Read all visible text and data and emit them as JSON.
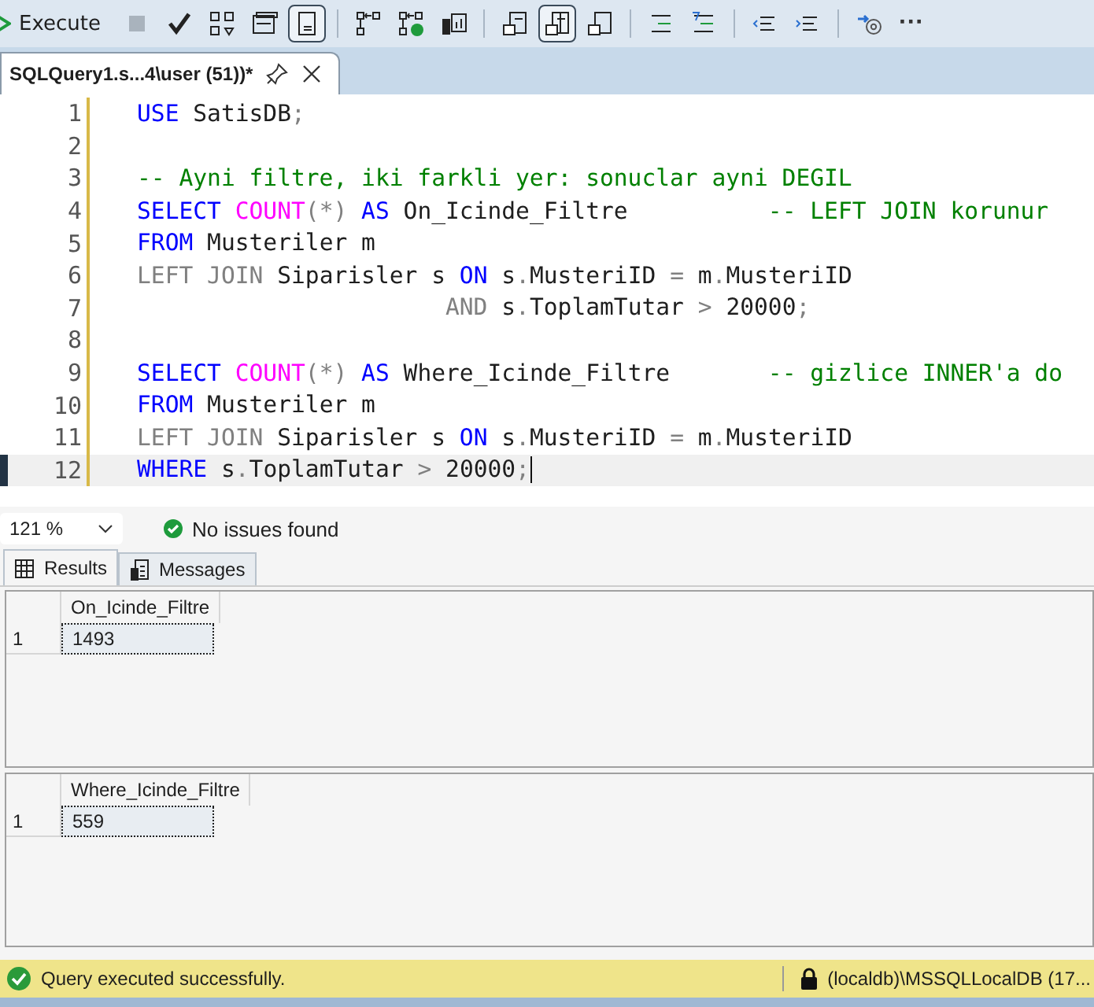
{
  "toolbar": {
    "execute": "Execute",
    "groups": [
      [
        {
          "kind": "stop",
          "selected": false
        },
        {
          "kind": "parse",
          "selected": false
        },
        {
          "kind": "plan",
          "selected": false
        },
        {
          "kind": "window",
          "selected": false
        },
        {
          "kind": "form",
          "selected": true
        }
      ],
      [
        {
          "kind": "link",
          "selected": false
        },
        {
          "kind": "linkok",
          "selected": false
        },
        {
          "kind": "stats",
          "selected": false
        }
      ],
      [
        {
          "kind": "text",
          "selected": false
        },
        {
          "kind": "grid",
          "selected": true
        },
        {
          "kind": "file",
          "selected": false
        }
      ],
      [
        {
          "kind": "comment",
          "selected": false
        },
        {
          "kind": "uncomment",
          "selected": false
        }
      ],
      [
        {
          "kind": "outdent",
          "selected": false
        },
        {
          "kind": "indent",
          "selected": false
        }
      ],
      [
        {
          "kind": "param",
          "selected": false
        }
      ]
    ],
    "more": "···"
  },
  "tabs": [
    {
      "label": "SQLQuery1.s...4\\user (51))*",
      "selected": true
    }
  ],
  "editor": {
    "lines": [
      {
        "number": "1",
        "tokens": [
          {
            "kind": "kw",
            "text": "USE"
          },
          {
            "kind": "id",
            "text": " SatisDB"
          },
          {
            "kind": "op",
            "text": ";"
          }
        ]
      },
      {
        "number": "2"
      },
      {
        "number": "3",
        "tokens": [
          {
            "kind": "cm",
            "text": "-- Ayni filtre, iki farkli yer: sonuclar ayni DEGIL"
          }
        ]
      },
      {
        "number": "4",
        "tokens": [
          {
            "kind": "kw",
            "text": "SELECT "
          },
          {
            "kind": "fn",
            "text": "COUNT"
          },
          {
            "kind": "op",
            "text": "(*)"
          },
          {
            "kind": "kw",
            "text": " AS"
          },
          {
            "kind": "id",
            "text": " On_Icinde_Filtre          "
          },
          {
            "kind": "cm",
            "text": "-- LEFT JOIN korunur"
          }
        ]
      },
      {
        "number": "5",
        "tokens": [
          {
            "kind": "kw",
            "text": "FROM"
          },
          {
            "kind": "id",
            "text": " Musteriler m"
          }
        ]
      },
      {
        "number": "6",
        "tokens": [
          {
            "kind": "op",
            "text": "LEFT JOIN"
          },
          {
            "kind": "id",
            "text": " Siparisler s "
          },
          {
            "kind": "kw",
            "text": "ON"
          },
          {
            "kind": "id",
            "text": " s"
          },
          {
            "kind": "op",
            "text": "."
          },
          {
            "kind": "id",
            "text": "MusteriID "
          },
          {
            "kind": "op",
            "text": "="
          },
          {
            "kind": "id",
            "text": " m"
          },
          {
            "kind": "op",
            "text": "."
          },
          {
            "kind": "id",
            "text": "MusteriID"
          }
        ]
      },
      {
        "number": "7",
        "tokens": [
          {
            "kind": "op",
            "text": "                      AND"
          },
          {
            "kind": "id",
            "text": " s"
          },
          {
            "kind": "op",
            "text": "."
          },
          {
            "kind": "id",
            "text": "ToplamTutar "
          },
          {
            "kind": "op",
            "text": ">"
          },
          {
            "kind": "id",
            "text": " 20000"
          },
          {
            "kind": "op",
            "text": ";"
          }
        ]
      },
      {
        "number": "8"
      },
      {
        "number": "9",
        "tokens": [
          {
            "kind": "kw",
            "text": "SELECT "
          },
          {
            "kind": "fn",
            "text": "COUNT"
          },
          {
            "kind": "op",
            "text": "(*)"
          },
          {
            "kind": "kw",
            "text": " AS"
          },
          {
            "kind": "id",
            "text": " Where_Icinde_Filtre       "
          },
          {
            "kind": "cm",
            "text": "-- gizlice INNER'a do"
          }
        ]
      },
      {
        "number": "10",
        "tokens": [
          {
            "kind": "kw",
            "text": "FROM"
          },
          {
            "kind": "id",
            "text": " Musteriler m"
          }
        ]
      },
      {
        "number": "11",
        "tokens": [
          {
            "kind": "op",
            "text": "LEFT JOIN"
          },
          {
            "kind": "id",
            "text": " Siparisler s "
          },
          {
            "kind": "kw",
            "text": "ON"
          },
          {
            "kind": "id",
            "text": " s"
          },
          {
            "kind": "op",
            "text": "."
          },
          {
            "kind": "id",
            "text": "MusteriID "
          },
          {
            "kind": "op",
            "text": "="
          },
          {
            "kind": "id",
            "text": " m"
          },
          {
            "kind": "op",
            "text": "."
          },
          {
            "kind": "id",
            "text": "MusteriID"
          }
        ]
      },
      {
        "number": "12",
        "current": true,
        "tokens": [
          {
            "kind": "kw",
            "text": "WHERE"
          },
          {
            "kind": "id",
            "text": " s"
          },
          {
            "kind": "op",
            "text": "."
          },
          {
            "kind": "id",
            "text": "ToplamTutar "
          },
          {
            "kind": "op",
            "text": ">"
          },
          {
            "kind": "id",
            "text": " 20000"
          },
          {
            "kind": "op",
            "text": ";"
          }
        ]
      }
    ]
  },
  "zoom": "121 %",
  "issues": "No issues found",
  "result_tabs": [
    {
      "label": "Results",
      "selected": true,
      "kind": "grid"
    },
    {
      "label": "Messages",
      "selected": false,
      "kind": "messages"
    }
  ],
  "grids": [
    {
      "column": "On_Icinde_Filtre",
      "rows": [
        {
          "number": "1",
          "value": "1493"
        }
      ]
    },
    {
      "column": "Where_Icinde_Filtre",
      "rows": [
        {
          "number": "1",
          "value": "559"
        }
      ]
    }
  ],
  "status_bar": {
    "message": "Query executed successfully.",
    "server": "(localdb)\\MSSQLLocalDB (17..."
  }
}
